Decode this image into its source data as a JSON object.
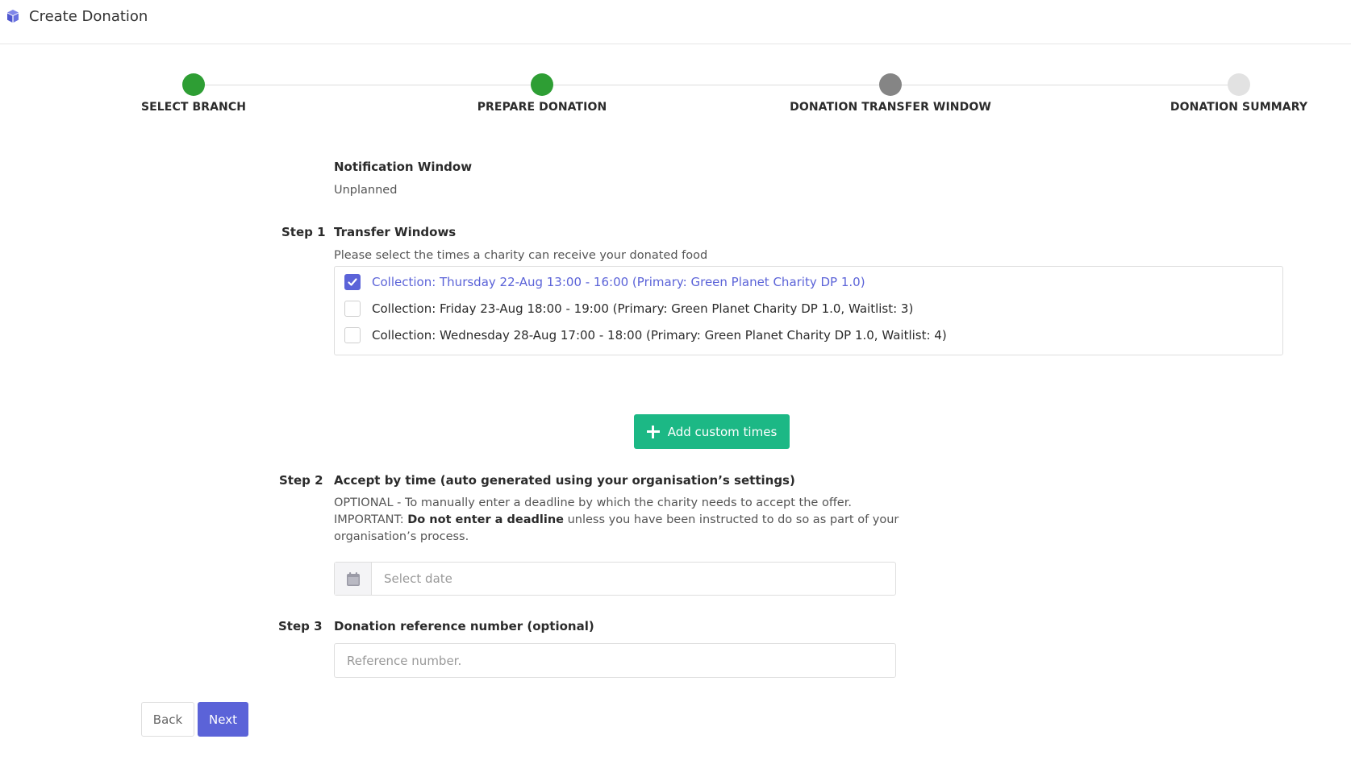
{
  "header": {
    "title": "Create Donation",
    "logo_icon": "cube-icon"
  },
  "stepper": {
    "steps": [
      {
        "label": "SELECT BRANCH",
        "state": "complete",
        "color": "#2e9e34"
      },
      {
        "label": "PREPARE DONATION",
        "state": "complete",
        "color": "#2e9e34"
      },
      {
        "label": "DONATION TRANSFER WINDOW",
        "state": "current",
        "color": "#858585"
      },
      {
        "label": "DONATION SUMMARY",
        "state": "upcoming",
        "color": "#e2e2e2"
      }
    ]
  },
  "notification": {
    "heading": "Notification Window",
    "value": "Unplanned"
  },
  "step1": {
    "tag": "Step 1",
    "heading": "Transfer Windows",
    "hint": "Please select the times a charity can receive your donated food",
    "options": [
      {
        "label": "Collection: Thursday 22-Aug 13:00 - 16:00 (Primary: Green Planet Charity DP 1.0)",
        "checked": true
      },
      {
        "label": "Collection: Friday 23-Aug 18:00 - 19:00 (Primary: Green Planet Charity DP 1.0, Waitlist: 3)",
        "checked": false
      },
      {
        "label": "Collection: Wednesday 28-Aug 17:00 - 18:00 (Primary: Green Planet Charity DP 1.0, Waitlist: 4)",
        "checked": false
      }
    ],
    "add_button_label": "Add custom times"
  },
  "step2": {
    "tag": "Step 2",
    "heading": "Accept by time (auto generated using your organisation’s settings)",
    "optional_text": "OPTIONAL - To manually enter a deadline by which the charity needs to accept the offer.",
    "important_prefix": "IMPORTANT: ",
    "important_bold": "Do not enter a deadline",
    "important_rest": " unless you have been instructed to do so as part of your",
    "important_line2": "organisation’s process.",
    "date_placeholder": "Select date"
  },
  "step3": {
    "tag": "Step 3",
    "heading": "Donation reference number (optional)",
    "ref_placeholder": "Reference number."
  },
  "footer": {
    "back_label": "Back",
    "next_label": "Next"
  },
  "colors": {
    "primary": "#5b63d8",
    "success": "#1cb885",
    "step_done": "#2e9e34"
  }
}
